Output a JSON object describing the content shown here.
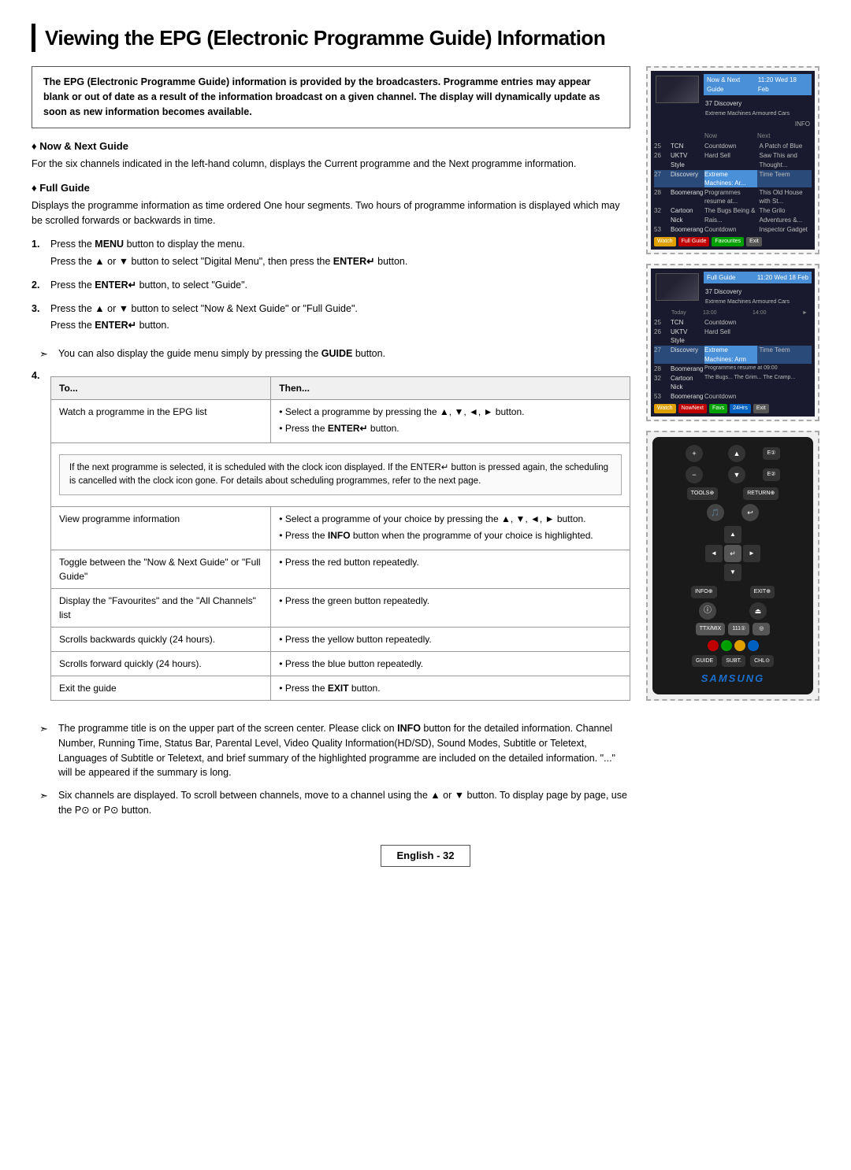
{
  "page": {
    "title": "Viewing the EPG (Electronic Programme Guide) Information",
    "footer_label": "English - 32"
  },
  "intro": {
    "text": "The EPG (Electronic Programme Guide) information is provided by the broadcasters. Programme entries may appear blank or out of date as a result of the information broadcast on a given channel. The display will dynamically update as soon as new information becomes available."
  },
  "sections": [
    {
      "id": "now_next",
      "header": "Now & Next Guide",
      "description": "For the six channels indicated in the left-hand column, displays the Current programme and the Next programme information."
    },
    {
      "id": "full_guide",
      "header": "Full Guide",
      "description": "Displays the programme information as time ordered One hour segments. Two hours of programme information is displayed which may be scrolled forwards or backwards in time."
    }
  ],
  "steps": [
    {
      "number": 1,
      "lines": [
        "Press the MENU button to display the menu.",
        "Press the ▲ or ▼ button to select \"Digital Menu\", then press the ENTER↵ button."
      ]
    },
    {
      "number": 2,
      "lines": [
        "Press the ENTER↵ button, to select \"Guide\"."
      ]
    },
    {
      "number": 3,
      "lines": [
        "Press the ▲ or ▼ button to select \"Now & Next Guide\" or \"Full Guide\".",
        "Press the ENTER↵ button."
      ]
    }
  ],
  "arrow_note": "You can also display the guide menu simply by pressing the GUIDE button.",
  "table": {
    "col1_header": "To...",
    "col2_header": "Then...",
    "rows": [
      {
        "col1": "Watch a programme in the EPG list",
        "col2": "• Select a programme by pressing the ▲, ▼, ◄, ► button.\n• Press the ENTER↵ button."
      },
      {
        "col1": "View programme information",
        "col2": "• Select a programme of your choice by pressing the ▲, ▼, ◄, ► button.\n• Press the INFO button when the programme of your choice is highlighted."
      },
      {
        "col1": "Toggle between the \"Now & Next Guide\" or \"Full Guide\"",
        "col2": "• Press the red button repeatedly."
      },
      {
        "col1": "Display the \"Favourites\" and the \"All Channels\" list",
        "col2": "• Press the green button repeatedly."
      },
      {
        "col1": "Scrolls backwards quickly (24 hours).",
        "col2": "• Press the yellow button repeatedly."
      },
      {
        "col1": "Scrolls forward quickly (24 hours).",
        "col2": "• Press the blue button repeatedly."
      },
      {
        "col1": "Exit the guide",
        "col2": "• Press the EXIT button."
      }
    ]
  },
  "note_box": {
    "text": "If the next programme is selected, it is scheduled with the clock icon displayed. If the ENTER↵ button is pressed again, the scheduling is cancelled with the clock icon gone. For details about scheduling programmes, refer to the next page."
  },
  "bottom_notes": [
    "The programme title is on the upper part of the screen center. Please click on INFO button for the detailed information. Channel Number, Running Time, Status Bar, Parental Level, Video Quality Information(HD/SD), Sound Modes, Subtitle or Teletext, Languages of Subtitle or Teletext, and brief summary of the highlighted programme are included on the detailed information. \"...\" will be appeared if the summary is long.",
    "Six channels are displayed. To scroll between channels, move to a channel using the ▲ or ▼ button. To display page by page, use the P⊙ or P⊙ button."
  ],
  "screens": [
    {
      "id": "now_next_screen",
      "title": "Now & Next Guide",
      "time": "11:20 Wed 18 Feb",
      "channels": [
        {
          "num": "25",
          "name": "TCN",
          "now": "Countdown",
          "next": "A Patch of Blue"
        },
        {
          "num": "26",
          "name": "UKTV Style",
          "now": "Hard Sell",
          "next": "Saw This and Thought..."
        },
        {
          "num": "27",
          "name": "Discovery",
          "now": "Extreme Machines: Ar...",
          "next": "Time Teem"
        },
        {
          "num": "28",
          "name": "Boomerang",
          "now": "Programmes resume at...",
          "next": "This Old House with St..."
        },
        {
          "num": "32",
          "name": "Cartoon Nick",
          "now": "The Bugs Being & Rais...",
          "next": "The Grilo Adventures &..."
        },
        {
          "num": "53",
          "name": "Boomerang",
          "now": "Countdown",
          "next": "Inspector Gadget"
        }
      ],
      "footer_btns": [
        "Watch",
        "Full Guide",
        "Favourites",
        "Exit"
      ]
    },
    {
      "id": "full_guide_screen",
      "title": "Full Guide",
      "time": "11:20 Wed 18 Feb",
      "channels": [
        {
          "num": "25",
          "name": "TCN",
          "col1": "Countdown",
          "col2": ""
        },
        {
          "num": "26",
          "name": "UKTV Style",
          "col1": "Hard Sell",
          "col2": ""
        },
        {
          "num": "27",
          "name": "Discovery",
          "col1": "Extreme Machines: Arm",
          "col2": "Time Teem"
        },
        {
          "num": "28",
          "name": "Boomerang",
          "col1": "Programmes resume at 09:00",
          "col2": ""
        },
        {
          "num": "32",
          "name": "Cartoon Nick",
          "col1": "The Bugs...",
          "col2": "The Grim... The Cramp... Doctor's L..."
        },
        {
          "num": "53",
          "name": "Boomerang",
          "col1": "Countdown",
          "col2": ""
        }
      ],
      "footer_btns": [
        "Watch",
        "NowNext",
        "Favourites",
        "24Hours",
        "Exit"
      ]
    }
  ],
  "remote": {
    "brand": "SAMSUNG"
  }
}
